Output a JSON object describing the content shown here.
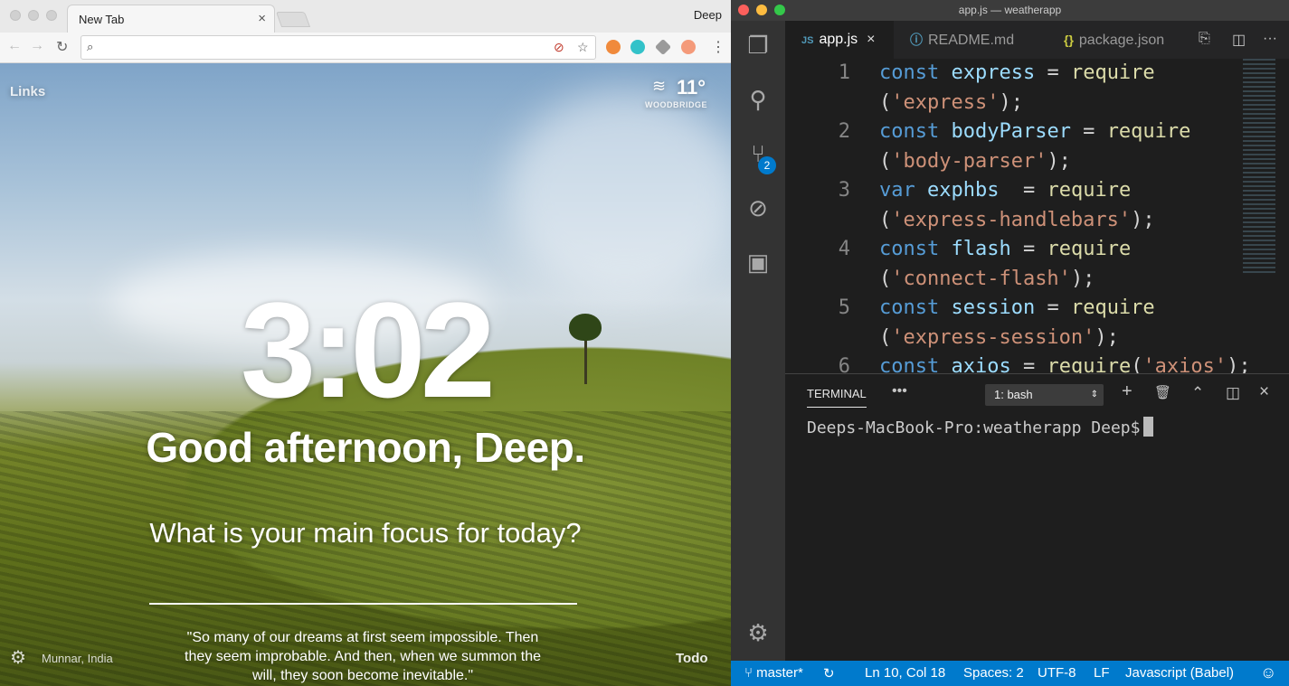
{
  "chrome": {
    "tab_title": "New Tab",
    "tab_close": "×",
    "profile_name": "Deep",
    "nav": {
      "back": "←",
      "forward": "→",
      "reload": "↻"
    },
    "omnibox_icons": {
      "search": "⌕",
      "tracker": "⊘",
      "bookmark": "☆",
      "menu": "⋮"
    },
    "extensions": [
      {
        "name": "orange-extension",
        "color": "#f08a3c"
      },
      {
        "name": "teal-extension",
        "color": "#33c2c9"
      },
      {
        "name": "layers-extension",
        "color": "#9a9a9a"
      },
      {
        "name": "dribbble-extension",
        "color": "#f49a7a"
      }
    ]
  },
  "newtab": {
    "links_label": "Links",
    "weather_icon": "≋",
    "weather_temp": "11°",
    "weather_location": "WOODBRIDGE",
    "clock": "3:02",
    "greeting": "Good afternoon, Deep.",
    "focus_question": "What is your main focus for today?",
    "settings_icon": "⚙",
    "photo_location": "Munnar, India",
    "quote": "\"So many of our dreams at first seem impossible. Then they seem improbable. And then, when we summon the will, they soon become inevitable.\"",
    "todo_label": "Todo"
  },
  "vscode": {
    "window_title": "app.js — weatherapp",
    "traffic_colors": [
      "#fc605c",
      "#fdbc40",
      "#34c84a"
    ],
    "activity": {
      "explorer_icon": "❐",
      "search_icon": "⚲",
      "scm_icon": "⑂",
      "scm_badge": "2",
      "debug_icon": "⊘",
      "extensions_icon": "▣",
      "settings_icon": "⚙"
    },
    "tabs": [
      {
        "glyph": "JS",
        "label": "app.js",
        "close": "×"
      },
      {
        "glyph": "ⓘ",
        "label": "README.md"
      },
      {
        "glyph": "{}",
        "label": "package.json"
      }
    ],
    "tab_actions": {
      "open_preview": "⎘",
      "split": "◫",
      "more": "···"
    },
    "code": [
      {
        "ln": "1",
        "parts": [
          [
            "kw",
            "const"
          ],
          [
            "t",
            " "
          ],
          [
            "id",
            "express"
          ],
          [
            "t",
            " = "
          ],
          [
            "fn",
            "require"
          ]
        ]
      },
      {
        "ln": "",
        "parts": [
          [
            "t",
            "("
          ],
          [
            "str",
            "'express'"
          ],
          [
            "t",
            ");"
          ]
        ]
      },
      {
        "ln": "2",
        "parts": [
          [
            "kw",
            "const"
          ],
          [
            "t",
            " "
          ],
          [
            "id",
            "bodyParser"
          ],
          [
            "t",
            " = "
          ],
          [
            "fn",
            "require"
          ]
        ]
      },
      {
        "ln": "",
        "parts": [
          [
            "t",
            "("
          ],
          [
            "str",
            "'body-parser'"
          ],
          [
            "t",
            ");"
          ]
        ]
      },
      {
        "ln": "3",
        "parts": [
          [
            "kw",
            "var"
          ],
          [
            "t",
            " "
          ],
          [
            "id",
            "exphbs"
          ],
          [
            "t",
            "  = "
          ],
          [
            "fn",
            "require"
          ]
        ]
      },
      {
        "ln": "",
        "parts": [
          [
            "t",
            "("
          ],
          [
            "str",
            "'express-handlebars'"
          ],
          [
            "t",
            ");"
          ]
        ]
      },
      {
        "ln": "4",
        "parts": [
          [
            "kw",
            "const"
          ],
          [
            "t",
            " "
          ],
          [
            "id",
            "flash"
          ],
          [
            "t",
            " = "
          ],
          [
            "fn",
            "require"
          ]
        ]
      },
      {
        "ln": "",
        "parts": [
          [
            "t",
            "("
          ],
          [
            "str",
            "'connect-flash'"
          ],
          [
            "t",
            ");"
          ]
        ]
      },
      {
        "ln": "5",
        "parts": [
          [
            "kw",
            "const"
          ],
          [
            "t",
            " "
          ],
          [
            "id",
            "session"
          ],
          [
            "t",
            " = "
          ],
          [
            "fn",
            "require"
          ]
        ]
      },
      {
        "ln": "",
        "parts": [
          [
            "t",
            "("
          ],
          [
            "str",
            "'express-session'"
          ],
          [
            "t",
            ");"
          ]
        ]
      },
      {
        "ln": "6",
        "parts": [
          [
            "kw",
            "const"
          ],
          [
            "t",
            " "
          ],
          [
            "id",
            "axios"
          ],
          [
            "t",
            " = "
          ],
          [
            "fn",
            "require"
          ],
          [
            "t",
            "("
          ],
          [
            "str",
            "'axios'"
          ],
          [
            "t",
            ");"
          ]
        ]
      }
    ],
    "panel": {
      "title": "TERMINAL",
      "more": "•••",
      "terminal_select": "1: bash",
      "select_arrow": "⇕",
      "actions": {
        "new": "+",
        "trash": "🗑",
        "maximize": "⌃",
        "split": "◫",
        "close": "×"
      },
      "prompt": "Deeps-MacBook-Pro:weatherapp Deep$"
    },
    "status": {
      "branch": "⑂ master*",
      "sync": "↻",
      "position": "Ln 10, Col 18",
      "indent": "Spaces: 2",
      "encoding": "UTF-8",
      "eol": "LF",
      "language": "Javascript (Babel)",
      "feedback": "☺"
    }
  }
}
